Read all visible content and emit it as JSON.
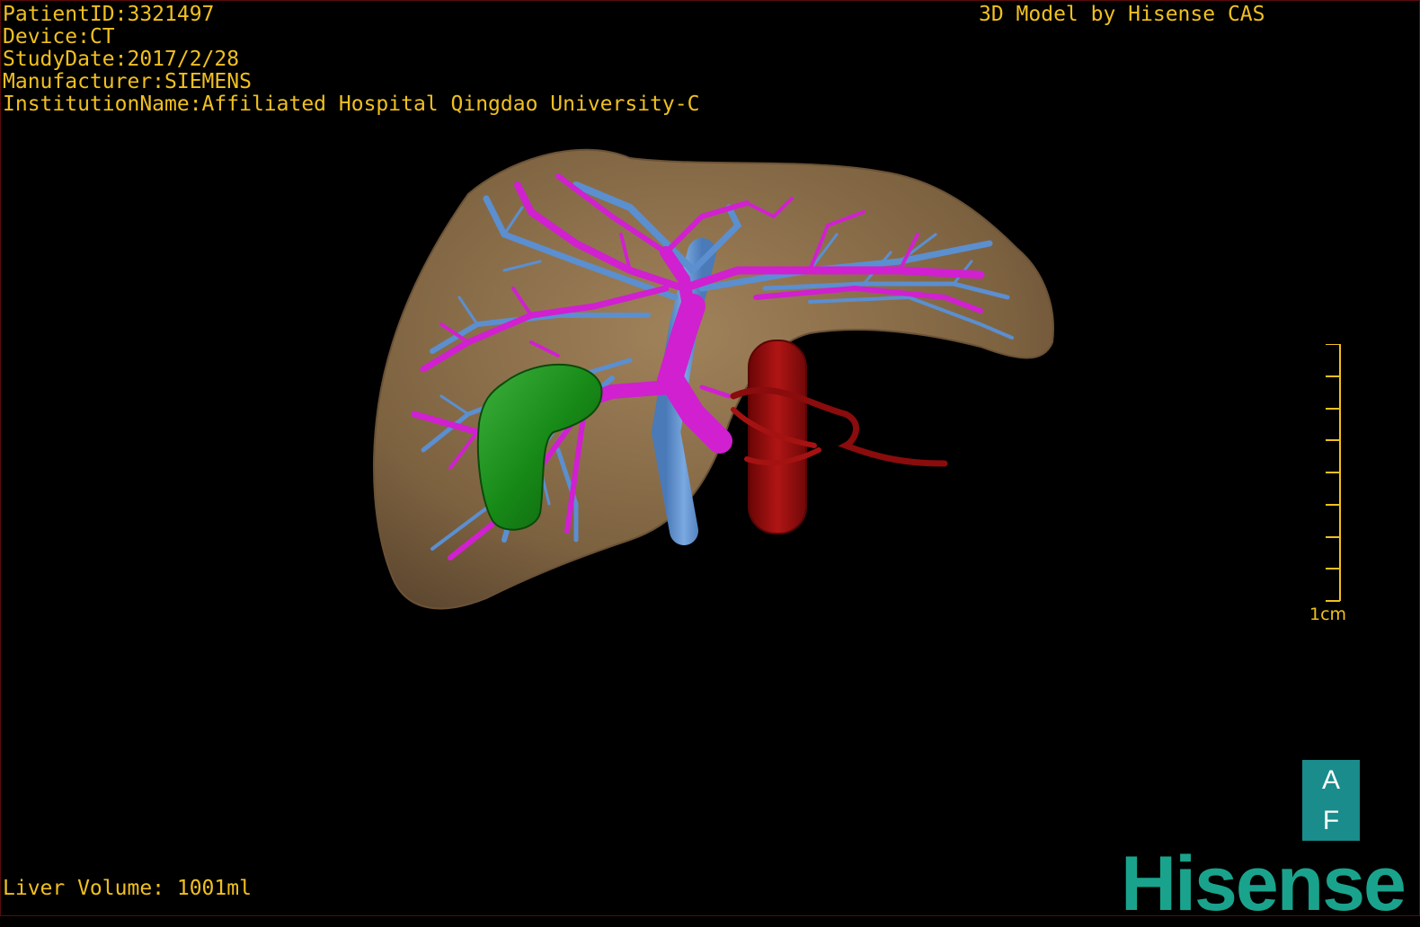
{
  "patient_info": {
    "patient_id": "PatientID:3321497",
    "device": "Device:CT",
    "study_date": "StudyDate:2017/2/28",
    "manufacturer": "Manufacturer:SIEMENS",
    "institution": "InstitutionName:Affiliated Hospital Qingdao University-C"
  },
  "model_credit": "3D Model by Hisense CAS",
  "liver_volume": "Liver Volume: 1001ml",
  "scale": {
    "label": "1cm",
    "tick_count": 9
  },
  "orientation": {
    "top_letter": "A",
    "bottom_letter": "F"
  },
  "brand": "Hisense",
  "structures": [
    {
      "name": "liver-parenchyma",
      "color": "#8a6a45"
    },
    {
      "name": "hepatic-vein",
      "color": "#5b8fd0"
    },
    {
      "name": "portal-vein",
      "color": "#d020d0"
    },
    {
      "name": "tumor-lesion",
      "color": "#1a8a1a"
    },
    {
      "name": "aorta-artery",
      "color": "#9a1010"
    }
  ],
  "colors": {
    "overlay_text": "#f0c020",
    "brand": "#1aa38c",
    "background": "#000000"
  }
}
